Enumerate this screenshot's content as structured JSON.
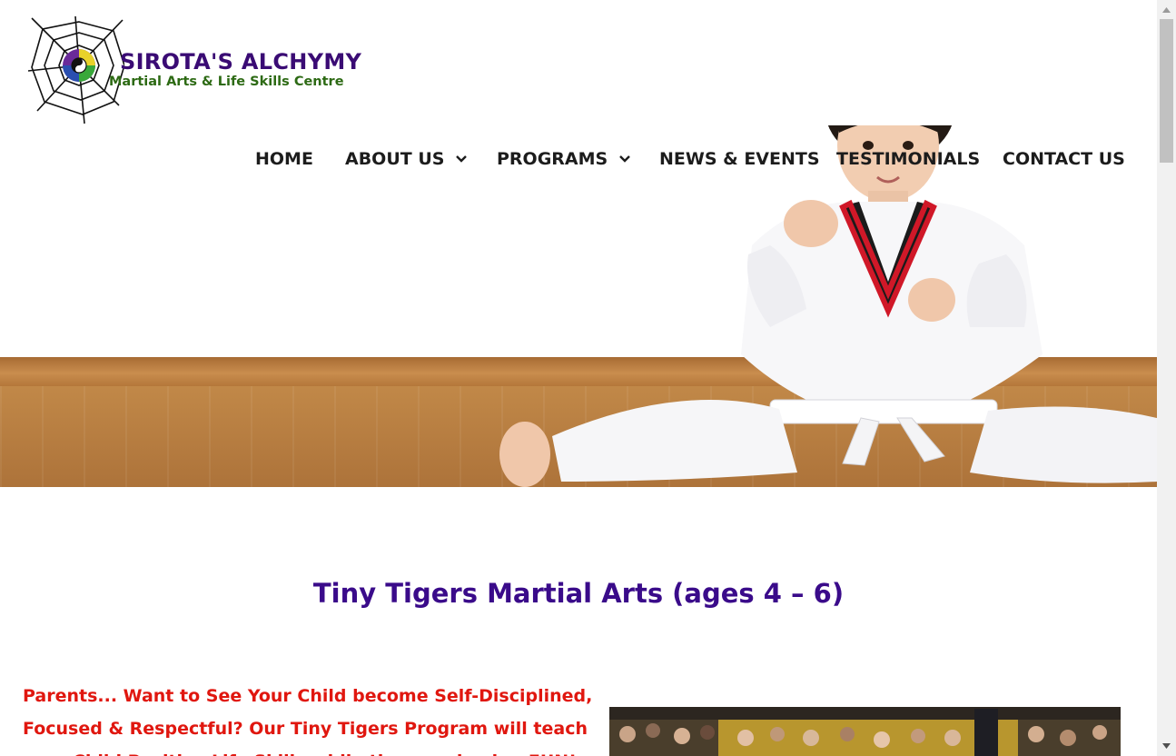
{
  "logo": {
    "title": "SIROTA'S ALCHYMY",
    "subtitle": "Martial Arts & Life Skills Centre"
  },
  "nav": {
    "items": [
      {
        "label": "HOME",
        "has_dropdown": false
      },
      {
        "label": "ABOUT US",
        "has_dropdown": true
      },
      {
        "label": "PROGRAMS",
        "has_dropdown": true
      },
      {
        "label": "NEWS & EVENTS",
        "has_dropdown": false
      },
      {
        "label": "TESTIMONIALS",
        "has_dropdown": false
      },
      {
        "label": "CONTACT US",
        "has_dropdown": false
      }
    ],
    "dropdown_icon": "chevron-down-icon"
  },
  "page": {
    "title": "Tiny Tigers Martial Arts (ages 4 – 6)",
    "intro_lines": [
      "Parents... Want to See Your Child become Self-Disciplined,",
      "Focused & Respectful? Our Tiny Tigers Program will teach",
      "your Child Positive Life Skills while they are having FUN!"
    ]
  },
  "colors": {
    "title": "#3a0b8a",
    "intro": "#e0170f",
    "nav_text": "#1c1c1c",
    "logo_title": "#3a0b74",
    "logo_subtitle": "#2d6a14"
  },
  "scrollbar": {
    "up_icon": "arrow-up-icon",
    "down_icon": "arrow-down-icon"
  }
}
